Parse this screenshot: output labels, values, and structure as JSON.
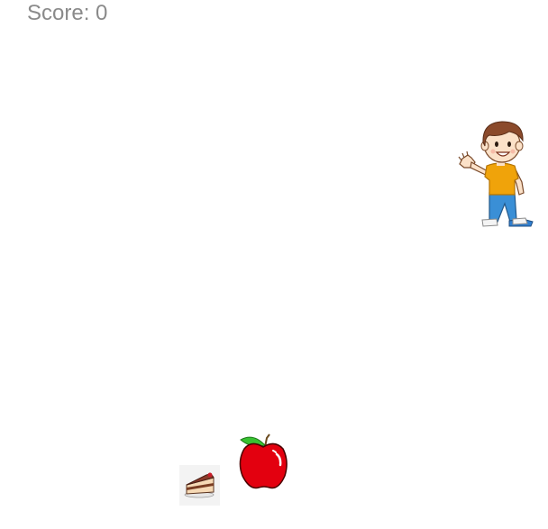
{
  "score": {
    "label": "Score: 0",
    "value": 0
  },
  "sprites": {
    "player": "boy-character",
    "items": [
      "apple",
      "cake-slice"
    ]
  },
  "colors": {
    "score_text": "#8a8a8a",
    "apple": "#e3000f",
    "shirt": "#f0a30a",
    "pants": "#3a8fd6"
  }
}
